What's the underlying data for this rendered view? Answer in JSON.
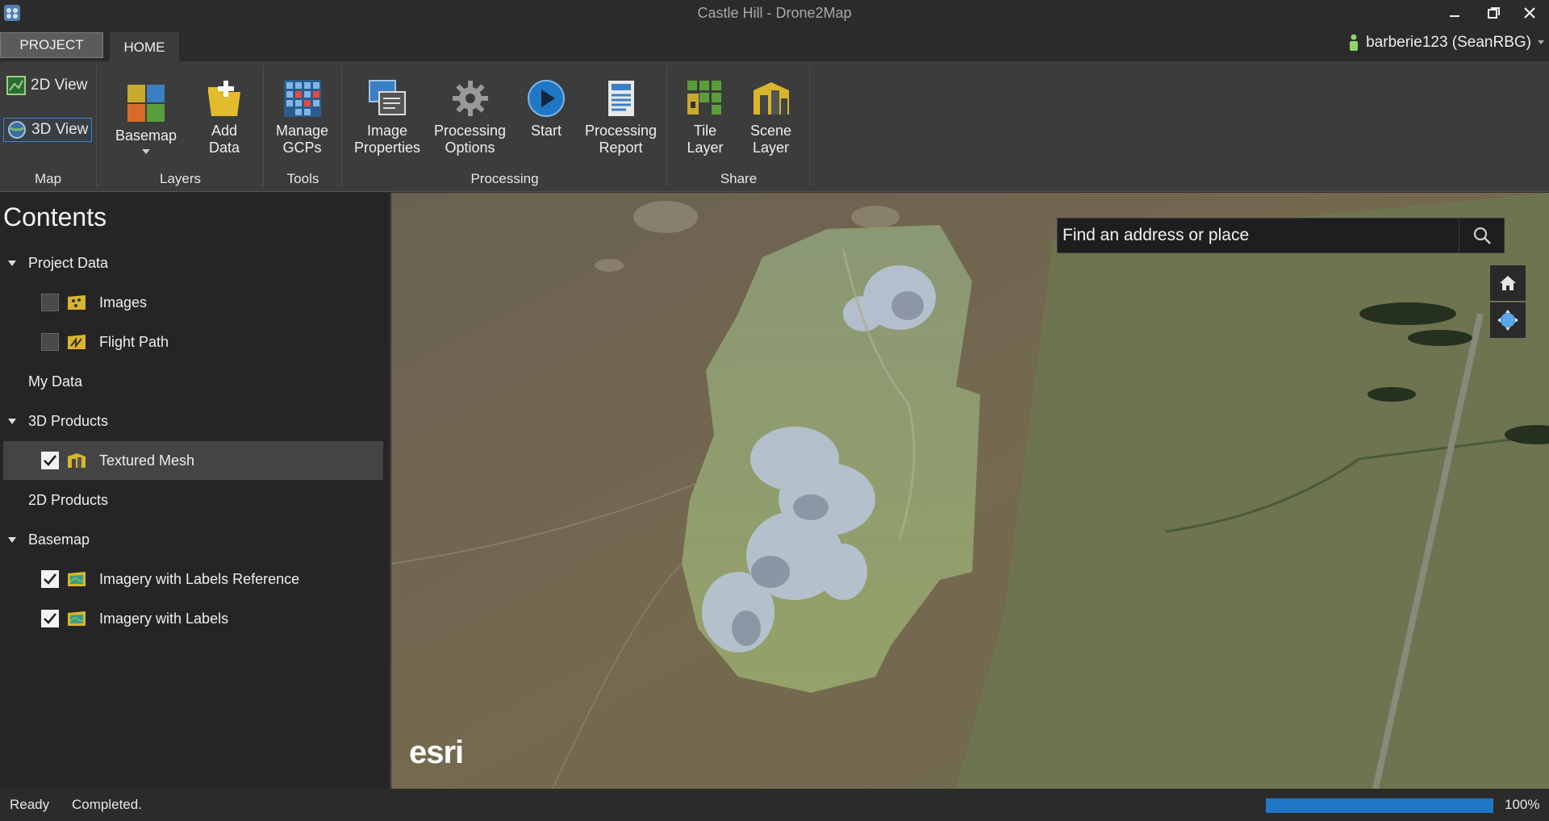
{
  "window": {
    "title": "Castle Hill - Drone2Map"
  },
  "tabs": {
    "project": "PROJECT",
    "home": "HOME"
  },
  "user": {
    "name": "barberie123 (SeanRBG)"
  },
  "ribbon": {
    "map": {
      "label": "Map",
      "view2d": "2D View",
      "view3d": "3D View"
    },
    "layers": {
      "label": "Layers",
      "basemap": "Basemap",
      "add_data_1": "Add",
      "add_data_2": "Data"
    },
    "tools": {
      "label": "Tools",
      "gcps_1": "Manage",
      "gcps_2": "GCPs"
    },
    "processing": {
      "label": "Processing",
      "image_props_1": "Image",
      "image_props_2": "Properties",
      "options_1": "Processing",
      "options_2": "Options",
      "start": "Start",
      "report_1": "Processing",
      "report_2": "Report"
    },
    "share": {
      "label": "Share",
      "tile_1": "Tile",
      "tile_2": "Layer",
      "scene_1": "Scene",
      "scene_2": "Layer"
    }
  },
  "contents": {
    "title": "Contents",
    "project_data": "Project Data",
    "images": "Images",
    "flight_path": "Flight Path",
    "my_data": "My Data",
    "products_3d": "3D Products",
    "textured_mesh": "Textured Mesh",
    "products_2d": "2D Products",
    "basemap": "Basemap",
    "imagery_labels_ref": "Imagery with Labels Reference",
    "imagery_labels": "Imagery with Labels"
  },
  "map": {
    "search_placeholder": "Find an address or place",
    "attribution": "esri"
  },
  "status": {
    "ready": "Ready",
    "message": "Completed.",
    "progress": 100,
    "progress_label": "100%"
  },
  "colors": {
    "accent": "#2f86d6",
    "progress": "#1f77c6",
    "layer_icon": "#d9b52b"
  }
}
